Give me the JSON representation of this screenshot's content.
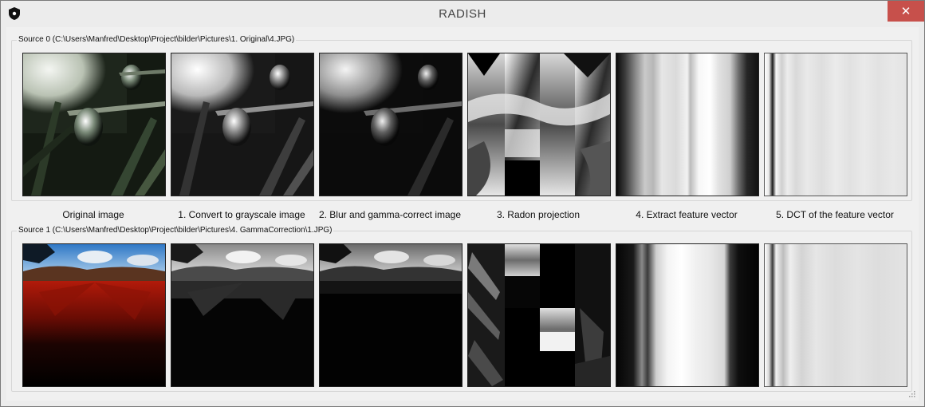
{
  "window": {
    "title": "RADISH",
    "close_label": "✕"
  },
  "sources": [
    {
      "label": "Source 0 (C:\\Users\\Manfred\\Desktop\\Project\\bilder\\Pictures\\1. Original\\4.JPG)"
    },
    {
      "label": "Source 1 (C:\\Users\\Manfred\\Desktop\\Project\\bilder\\Pictures\\4. GammaCorrection\\1.JPG)"
    }
  ],
  "steps": [
    {
      "label": "Original image"
    },
    {
      "label": "1. Convert to grayscale image"
    },
    {
      "label": "2. Blur and gamma-correct image"
    },
    {
      "label": "3. Radon projection"
    },
    {
      "label": "4. Extract feature vector"
    },
    {
      "label": "5. DCT of the feature vector"
    }
  ],
  "colors": {
    "close_button": "#c7504b",
    "window_bg": "#ececec",
    "group_border": "#d6d6d6"
  },
  "icons": {
    "app": "shield-icon",
    "close": "close-icon",
    "grip": "resize-grip-icon"
  }
}
